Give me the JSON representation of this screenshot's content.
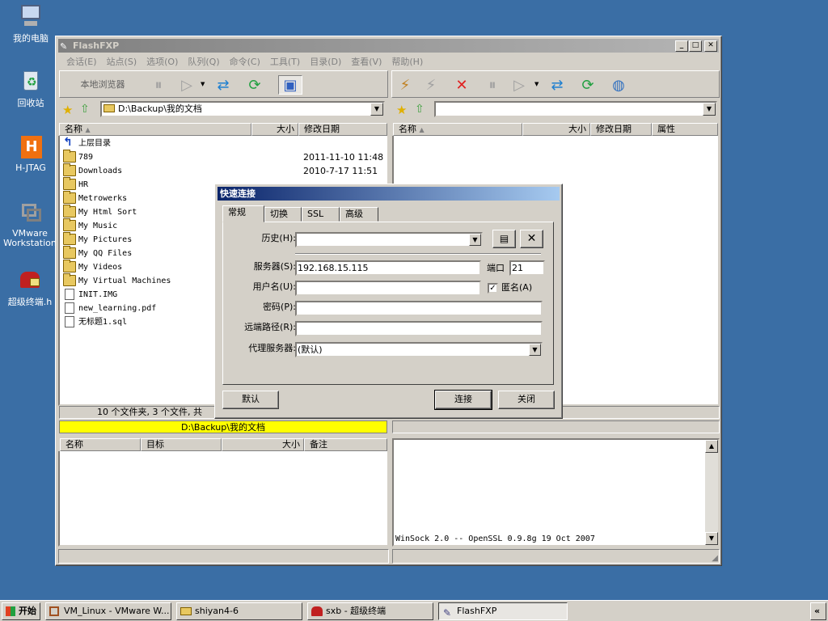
{
  "desktop": {
    "icons": [
      {
        "label": "我的电脑",
        "icon": "computer-icon"
      },
      {
        "label": "回收站",
        "icon": "recycle-bin-icon"
      },
      {
        "label": "H-JTAG",
        "icon": "hjtag-icon"
      },
      {
        "label": "VMware Workstation",
        "icon": "vmware-icon"
      },
      {
        "label": "超级终端.h",
        "icon": "hyperterminal-icon"
      }
    ]
  },
  "window": {
    "title": "FlashFXP",
    "menu": [
      "会话(E)",
      "站点(S)",
      "选项(O)",
      "队列(Q)",
      "命令(C)",
      "工具(T)",
      "目录(D)",
      "查看(V)",
      "帮助(H)"
    ],
    "local_browser_label": "本地浏览器",
    "left_path": "D:\\Backup\\我的文档",
    "right_path": "",
    "left_columns": [
      "名称",
      "大小",
      "修改日期"
    ],
    "right_columns": [
      "名称",
      "大小",
      "修改日期",
      "属性"
    ],
    "files": [
      {
        "name": "上层目录",
        "date": "",
        "type": "up"
      },
      {
        "name": "789",
        "date": "2011-11-10 11:48",
        "type": "folder"
      },
      {
        "name": "Downloads",
        "date": "2010-7-17 11:51",
        "type": "folder"
      },
      {
        "name": "HR",
        "date": "",
        "type": "folder"
      },
      {
        "name": "Metrowerks",
        "date": "",
        "type": "folder"
      },
      {
        "name": "My Html Sort",
        "date": "",
        "type": "folder"
      },
      {
        "name": "My Music",
        "date": "",
        "type": "folder"
      },
      {
        "name": "My Pictures",
        "date": "",
        "type": "folder"
      },
      {
        "name": "My QQ Files",
        "date": "",
        "type": "folder"
      },
      {
        "name": "My Videos",
        "date": "",
        "type": "folder"
      },
      {
        "name": "My Virtual Machines",
        "date": "",
        "type": "folder"
      },
      {
        "name": "INIT.IMG",
        "date": "",
        "type": "file"
      },
      {
        "name": "new_learning.pdf",
        "date": "",
        "type": "file"
      },
      {
        "name": "无标题1.sql",
        "date": "",
        "type": "file"
      }
    ],
    "left_status": "10 个文件夹, 3 个文件, 共",
    "left_path_status": "D:\\Backup\\我的文档",
    "queue_columns": [
      "名称",
      "目标",
      "大小",
      "备注"
    ],
    "log_text": "WinSock 2.0 -- OpenSSL 0.9.8g 19 Oct 2007"
  },
  "dialog": {
    "title": "快速连接",
    "tabs": [
      "常规",
      "切换",
      "SSL",
      "高级"
    ],
    "history_label": "历史(H):",
    "server_label": "服务器(S):",
    "server_value": "192.168.15.115",
    "port_label": "端口",
    "port_value": "21",
    "user_label": "用户名(U):",
    "anon_label": "匿名(A)",
    "pass_label": "密码(P):",
    "remote_label": "远端路径(R):",
    "proxy_label": "代理服务器:",
    "proxy_value": "(默认)",
    "default_button": "默认",
    "connect_button": "连接",
    "close_button": "关闭"
  },
  "taskbar": {
    "start": "开始",
    "items": [
      "VM_Linux - VMware W...",
      "shiyan4-6",
      "sxb - 超级终端",
      "FlashFXP"
    ],
    "tray": "«"
  }
}
